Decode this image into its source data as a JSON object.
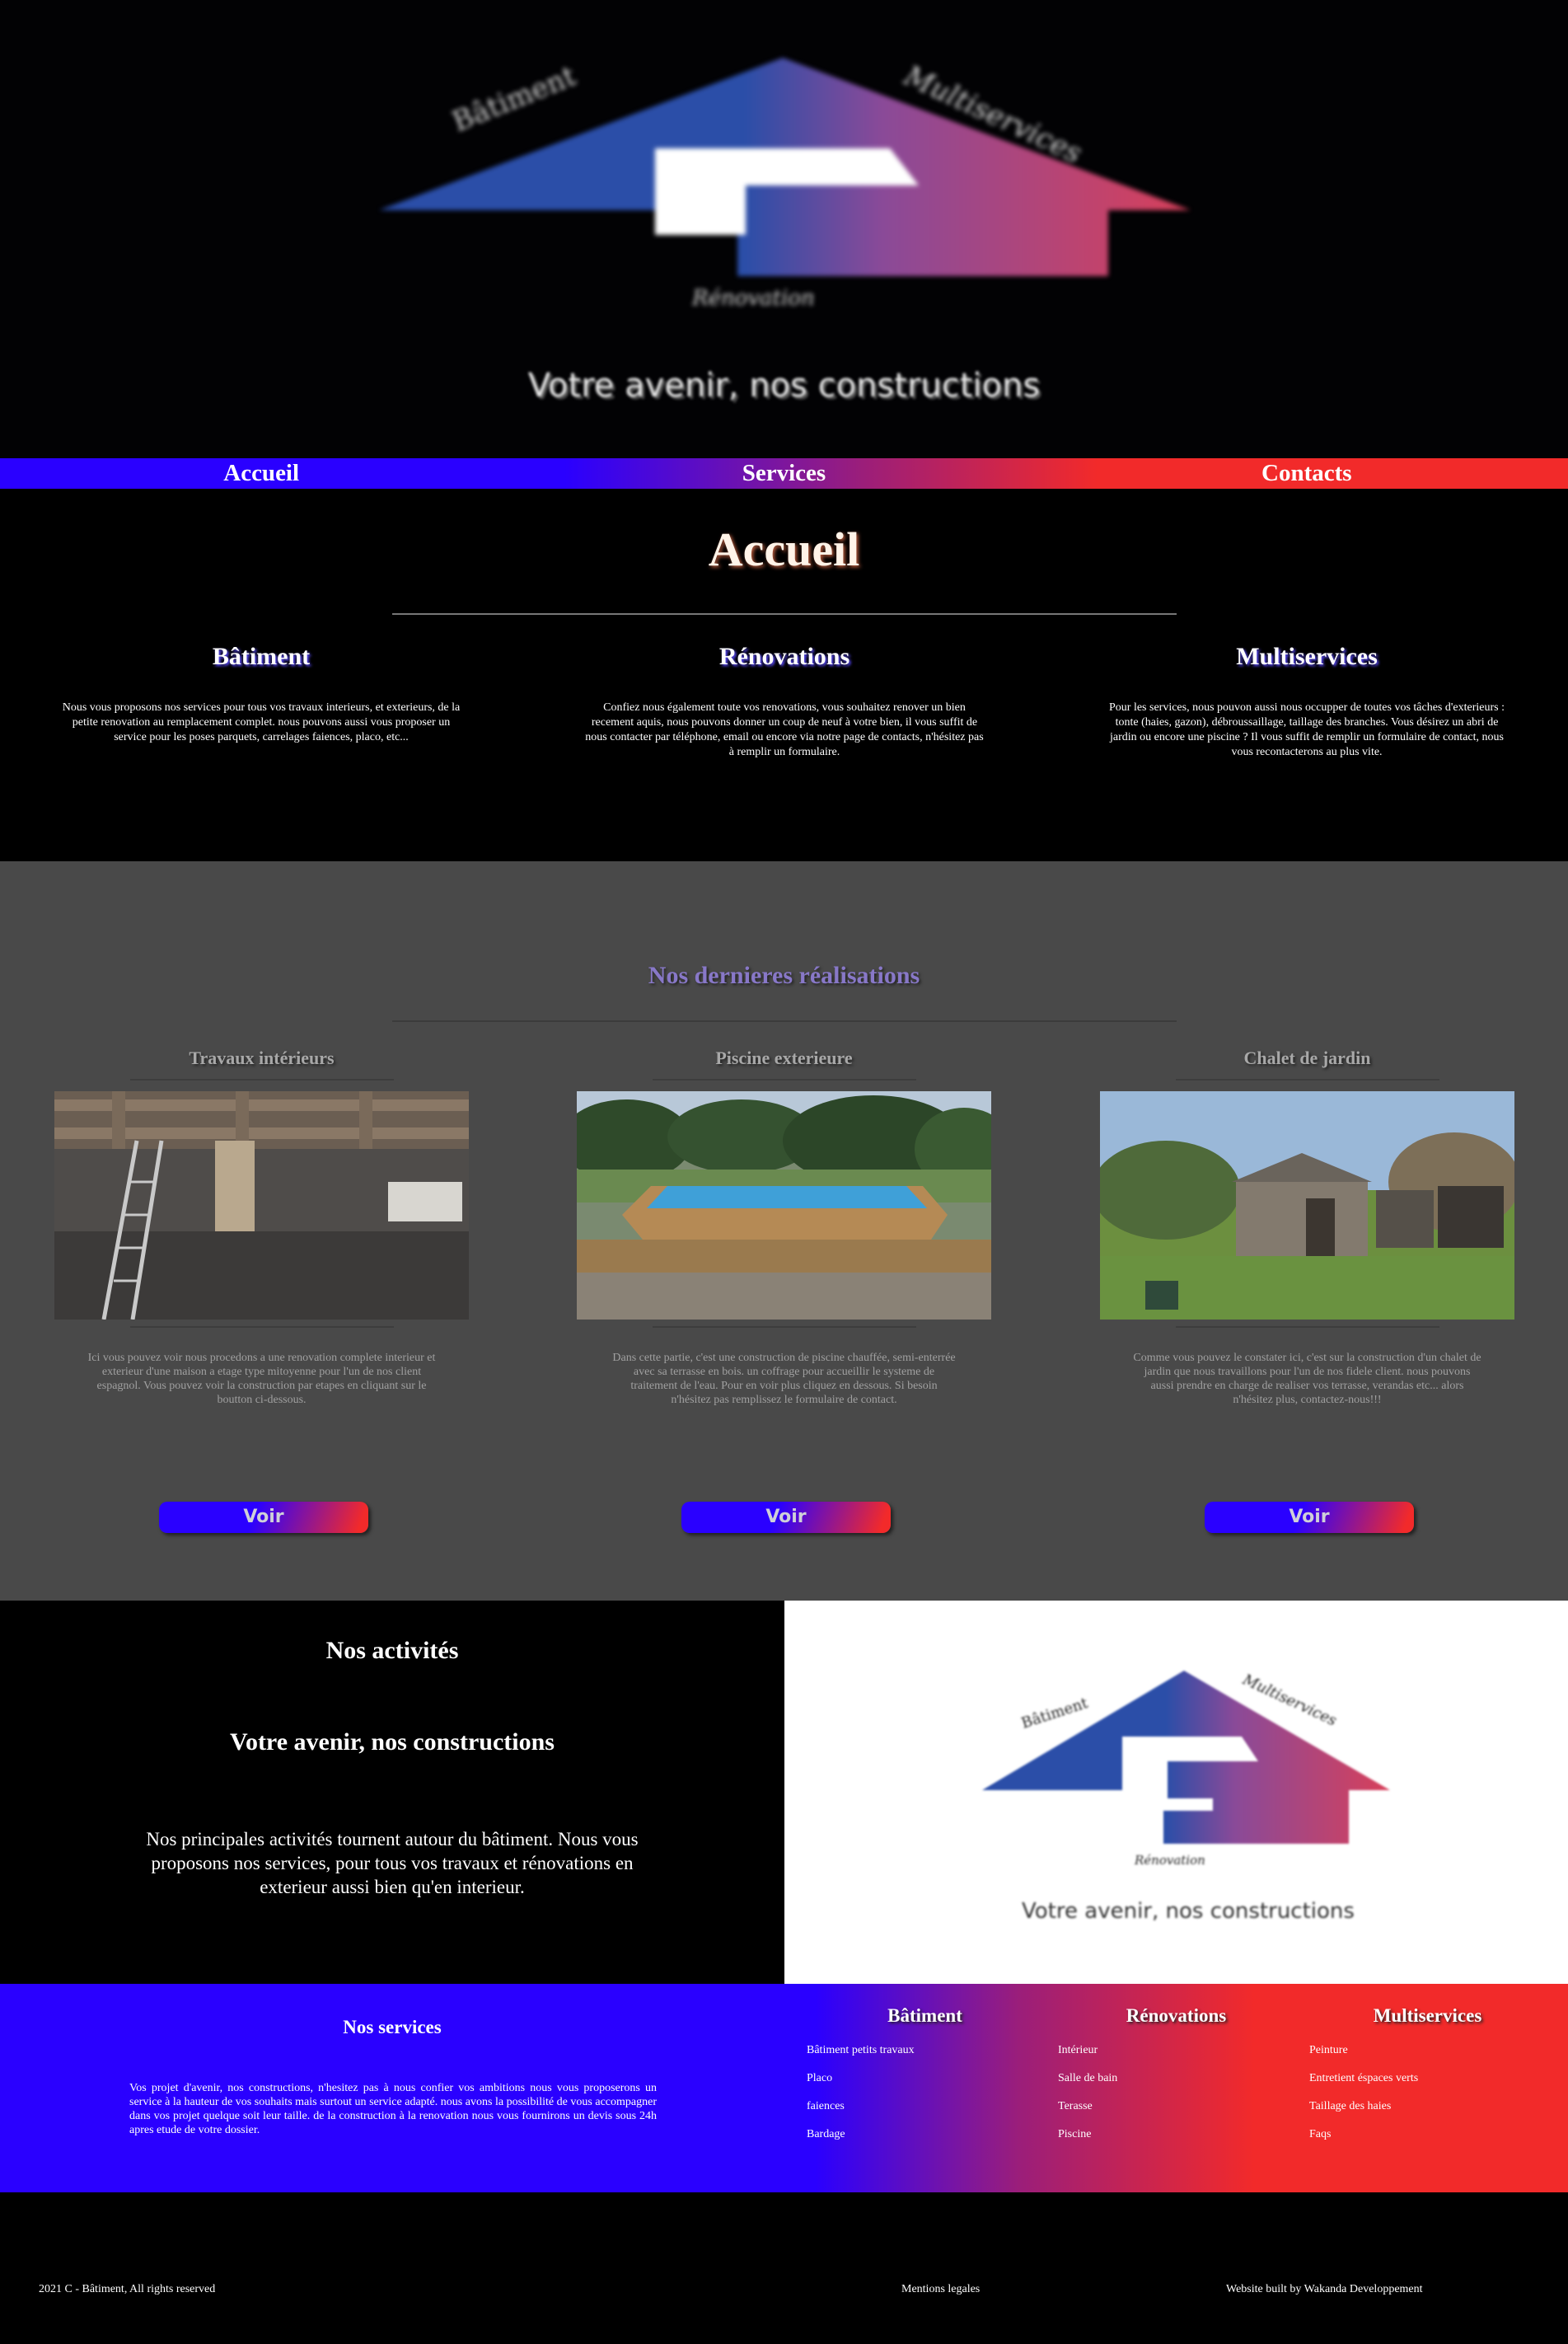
{
  "hero": {
    "logo_text_left": "Bâtiment",
    "logo_text_right": "Multiservices",
    "logo_text_bottom": "Rénovation",
    "tagline": "Votre avenir, nos constructions"
  },
  "nav": {
    "items": [
      "Accueil",
      "Services",
      "Contacts"
    ]
  },
  "accueil": {
    "title": "Accueil",
    "columns": [
      {
        "title": "Bâtiment",
        "text": "Nous vous proposons nos services pour tous vos travaux interieurs, et exterieurs, de la petite renovation au remplacement complet. nous pouvons aussi vous proposer un service pour les poses parquets, carrelages faiences, placo, etc..."
      },
      {
        "title": "Rénovations",
        "text": "Confiez nous également toute vos renovations, vous souhaitez renover un bien recement aquis, nous pouvons donner un coup de neuf à votre bien, il vous suffit de nous contacter par téléphone, email ou encore via notre page de contacts, n'hésitez pas à remplir un formulaire."
      },
      {
        "title": "Multiservices",
        "text": "Pour les services, nous pouvon aussi nous occupper de toutes vos tâches d'exterieurs : tonte (haies, gazon), débroussaillage, taillage des branches. Vous désirez un abri de jardin ou encore une piscine ? Il vous suffit de remplir un formulaire de contact, nous vous recontacterons au plus vite."
      }
    ]
  },
  "realisations": {
    "title": "Nos dernieres réalisations",
    "button_label": "Voir",
    "cards": [
      {
        "title": "Travaux intérieurs",
        "text": "Ici vous pouvez voir nous procedons a une renovation complete interieur et exterieur d'une maison a etage type mitoyenne pour l'un de nos client espagnol. Vous pouvez voir la construction par etapes en cliquant sur le boutton ci-dessous."
      },
      {
        "title": "Piscine exterieure",
        "text": "Dans cette partie, c'est une construction de piscine chauffée, semi-enterrée avec sa terrasse en bois. un coffrage pour accueillir le systeme de traitement de l'eau. Pour en voir plus cliquez en dessous. Si besoin n'hésitez pas remplissez le formulaire de contact."
      },
      {
        "title": "Chalet de jardin",
        "text": "Comme vous pouvez le constater ici, c'est sur la construction d'un chalet de jardin que nous travaillons pour l'un de nos fidele client. nous pouvons aussi prendre en charge de realiser vos terrasse, verandas etc... alors n'hésitez plus, contactez-nous!!!"
      }
    ]
  },
  "activites": {
    "title": "Nos activités",
    "subtitle": "Votre avenir, nos constructions",
    "text": "Nos principales activités tournent autour du bâtiment. Nous vous proposons nos services, pour tous vos travaux et rénovations en exterieur aussi bien qu'en interieur."
  },
  "services": {
    "title": "Nos services",
    "text": "Vos projet d'avenir, nos constructions, n'hesitez pas à nous confier vos ambitions nous vous proposerons un service à la hauteur de vos souhaits mais surtout un service adapté. nous avons la possibilité de vous accompagner dans vos projet quelque soit leur taille. de la construction à la renovation nous vous fournirons un devis sous 24h apres etude de votre dossier.",
    "columns": [
      {
        "title": "Bâtiment",
        "items": [
          "Bâtiment petits travaux",
          "Placo",
          "faiences",
          "Bardage"
        ]
      },
      {
        "title": "Rénovations",
        "items": [
          "Intérieur",
          "Salle de bain",
          "Terasse",
          "Piscine"
        ]
      },
      {
        "title": "Multiservices",
        "items": [
          "Peinture",
          "Entretient éspaces verts",
          "Taillage des haies",
          "Faqs"
        ]
      }
    ]
  },
  "footer": {
    "copyright": "2021 C - Bâtiment, All rights reserved",
    "legal": "Mentions legales",
    "credit": "Website built by Wakanda Developpement"
  },
  "colors": {
    "blue": "#2a00ff",
    "red": "#f22a2a",
    "grey": "#494949"
  }
}
